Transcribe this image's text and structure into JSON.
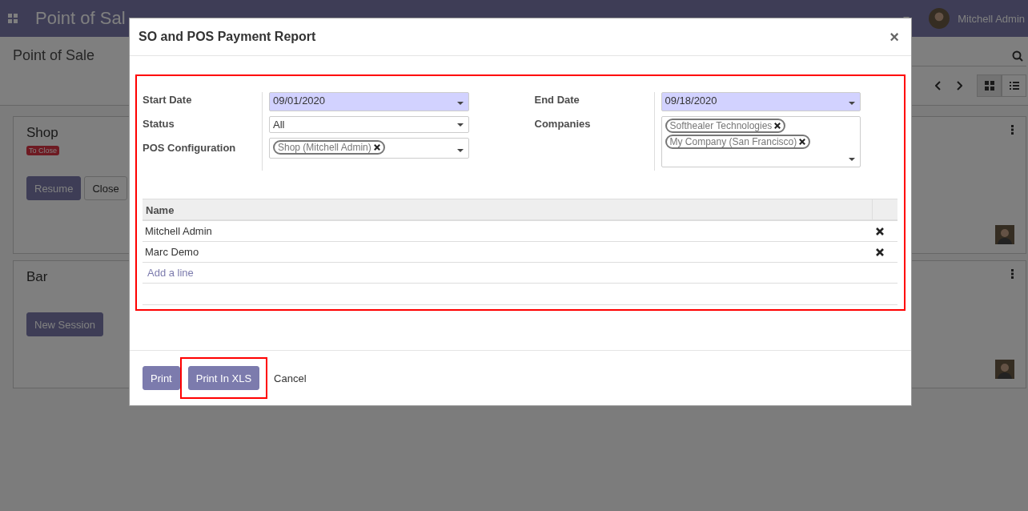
{
  "navbar": {
    "app_title": "Point of Sal",
    "user": "Mitchell Admin"
  },
  "control_panel": {
    "breadcrumb": "Point of Sale",
    "views": [
      {
        "kind": "kanban",
        "selected": true
      },
      {
        "kind": "list",
        "selected": false
      }
    ]
  },
  "cards": [
    {
      "name": "Shop",
      "badge": "To Close",
      "buttons": [
        {
          "label": "Resume",
          "kind": "primary"
        },
        {
          "label": "Close",
          "kind": "secondary"
        }
      ]
    },
    {
      "name": "Bar",
      "buttons": [
        {
          "label": "New Session",
          "kind": "primary"
        }
      ]
    }
  ],
  "dialog": {
    "title": "SO and POS Payment Report",
    "close": "×",
    "form_highlighted": true,
    "left_fields": [
      {
        "label": "Start Date",
        "kind": "date",
        "value": "09/01/2020"
      },
      {
        "label": "Status",
        "kind": "select",
        "value": "All"
      },
      {
        "label": "POS Configuration",
        "kind": "tags",
        "tags": [
          "Shop (Mitchell Admin)"
        ]
      }
    ],
    "right_fields": [
      {
        "label": "End Date",
        "kind": "date",
        "value": "09/18/2020"
      },
      {
        "label": "Companies",
        "kind": "tags",
        "tags": [
          "Softhealer Technologies",
          "My Company (San Francisco)"
        ]
      }
    ],
    "table": {
      "columns": [
        "Name"
      ],
      "rows": [
        {
          "name": "Mitchell Admin"
        },
        {
          "name": "Marc Demo"
        }
      ],
      "add_line": "Add a line"
    },
    "buttons": [
      {
        "label": "Print",
        "kind": "primary",
        "highlighted": false
      },
      {
        "label": "Print In XLS",
        "kind": "primary",
        "highlighted": true
      },
      {
        "label": "Cancel",
        "kind": "link",
        "highlighted": false
      }
    ]
  }
}
